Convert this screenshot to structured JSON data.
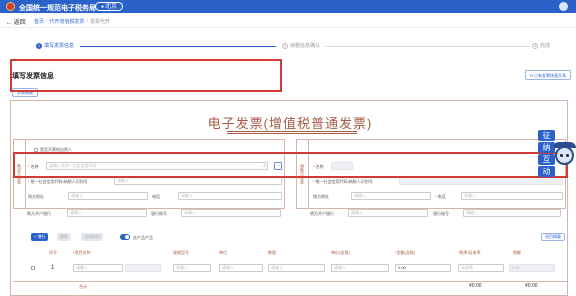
{
  "header": {
    "site_name": "全国统一规范电子税务局",
    "city": "北京",
    "city_icon": "location-pin-icon"
  },
  "nav": {
    "back_label": "返回",
    "breadcrumbs": [
      "首页",
      "代开增值税发票",
      "发票代开"
    ]
  },
  "steps": [
    {
      "num": "1",
      "label": "填写发票信息",
      "state": "active"
    },
    {
      "num": "2",
      "label": "纳税信息确认",
      "state": "todo"
    },
    {
      "num": "3",
      "label": "完成",
      "state": "todo"
    }
  ],
  "section": {
    "title": "填写发票信息",
    "copy_button": "⟲ 已有发票快速开具",
    "template_button": "发票模板"
  },
  "invoice": {
    "title": "电子发票(增值税普通发票)",
    "buyer_side_label": "购买方信息",
    "seller_side_label": "销售方信息",
    "natural_person_checkbox": "是否开票给自然人",
    "buyer": {
      "name_label": "名称",
      "name_placeholder": "请输入名称 / 社会信用代码",
      "tax_label": "统一社会信用代码/纳税人识别号",
      "tax_placeholder": "请输入",
      "address_label": "购方地址",
      "address_placeholder": "请输入",
      "phone_label": "电话",
      "phone_placeholder": "请输入",
      "bank_label": "购方开户银行",
      "bank_placeholder": "请输入",
      "account_label": "银行账号",
      "account_placeholder": "请输入"
    },
    "seller": {
      "name_label": "名称",
      "tax_label": "统一社会信用代码/纳税人识别号",
      "address_label": "销方地址",
      "address_placeholder": "请输入",
      "phone_label": "电话",
      "phone_placeholder": "请输入",
      "bank_label": "销方开户银行",
      "bank_placeholder": "请输入",
      "account_label": "银行账号",
      "account_placeholder": "请输入"
    }
  },
  "toolbar": {
    "add_row": "+ 增行",
    "delete_row": "删除",
    "discount": "添加折扣",
    "toggle_label": "含产品产品",
    "right_button": "项目摘要"
  },
  "table": {
    "headers": [
      "序号",
      "*项目名称",
      "规格型号",
      "单位",
      "数量",
      "单价(含税)",
      "*金额(含税)",
      "*税率/征收率",
      "税额"
    ],
    "row": {
      "index": "1",
      "item_placeholder": "请输入",
      "spec_placeholder": "请输入",
      "unit_placeholder": "请输入",
      "qty_placeholder": "请输入",
      "price_placeholder": "请输入",
      "amount": "0.00",
      "tax_rate_placeholder": "请选择",
      "tax_amount_placeholder": "0.00"
    },
    "total_label": "合计",
    "total_amount": "¥0.00",
    "total_tax": "¥0.00"
  },
  "mascot": {
    "bubbles": [
      "征",
      "纳",
      "互",
      "动"
    ]
  },
  "colors": {
    "primary": "#2a62c9",
    "invoice_brown": "#a65b44",
    "highlight_red": "#d03b35"
  }
}
